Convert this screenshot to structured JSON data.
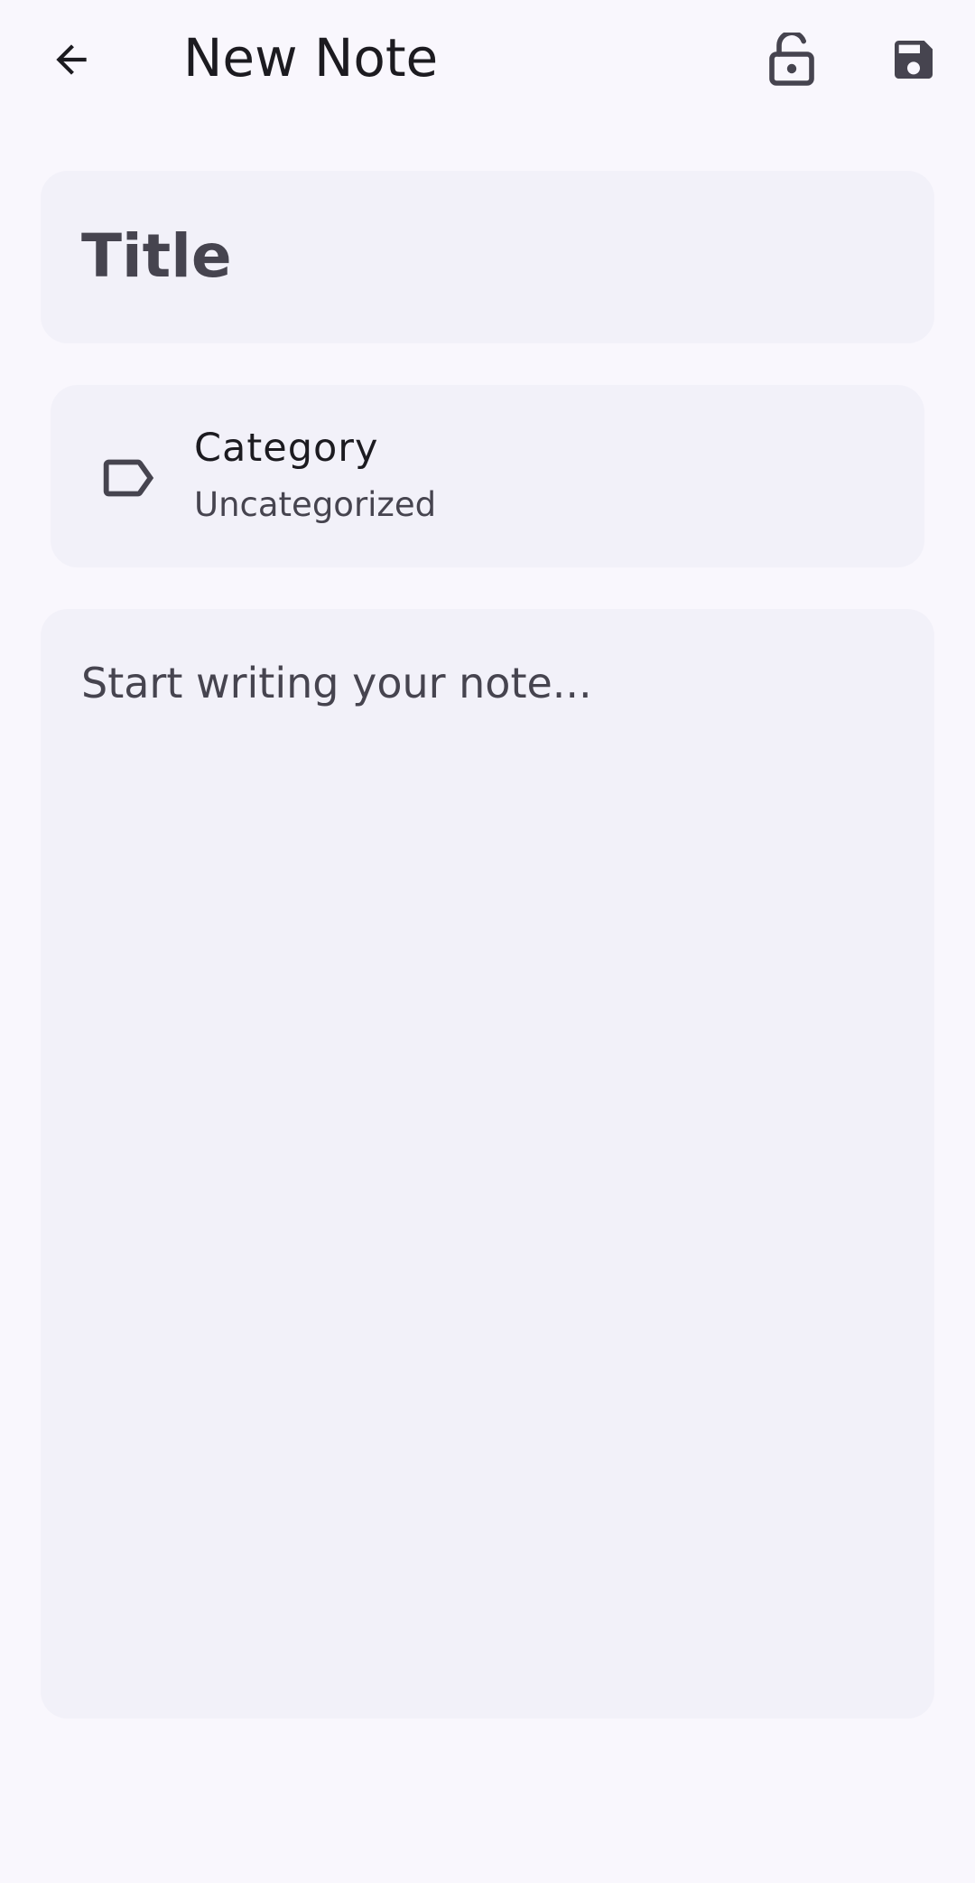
{
  "appbar": {
    "title": "New Note",
    "back_icon": "arrow-back-icon",
    "lock_icon": "lock-open-icon",
    "save_icon": "save-icon"
  },
  "title_field": {
    "placeholder": "Title",
    "value": ""
  },
  "category": {
    "icon": "label-icon",
    "title": "Category",
    "value": "Uncategorized"
  },
  "body_field": {
    "placeholder": "Start writing your note...",
    "value": ""
  },
  "colors": {
    "background": "#f9f7fd",
    "surface": "#f2f1f9",
    "on_surface": "#1c1b20",
    "on_surface_variant": "#46444f"
  }
}
